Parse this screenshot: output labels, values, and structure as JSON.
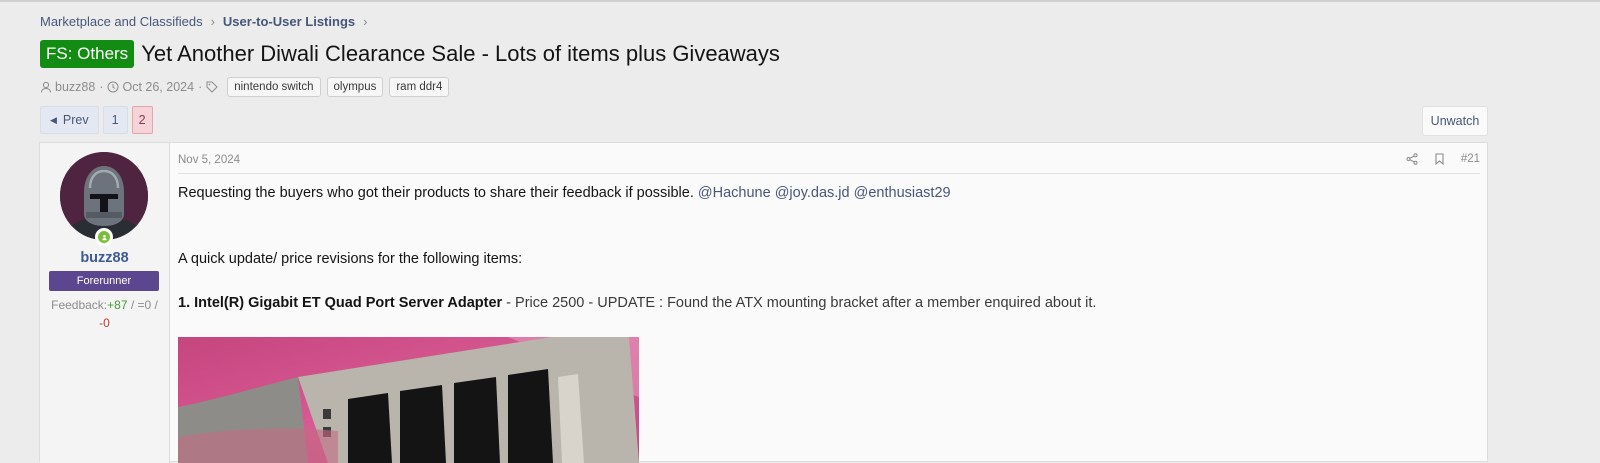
{
  "breadcrumb": {
    "items": [
      "Marketplace and Classifieds",
      "User-to-User Listings"
    ]
  },
  "thread": {
    "prefix": "FS: Others",
    "title": "Yet Another Diwali Clearance Sale - Lots of items plus Giveaways",
    "author": "buzz88",
    "date": "Oct 26, 2024",
    "tags": [
      "nintendo switch",
      "olympus",
      "ram ddr4"
    ]
  },
  "pager": {
    "prev_label": "Prev",
    "pages": [
      "1",
      "2"
    ],
    "current": "2"
  },
  "actions": {
    "unwatch_label": "Unwatch"
  },
  "post": {
    "date": "Nov 5, 2024",
    "number": "#21",
    "user": {
      "name": "buzz88",
      "title": "Forerunner",
      "feedback_label": "Feedback:",
      "feedback_pos": "+87",
      "feedback_sep1": " / ",
      "feedback_neu": "=0",
      "feedback_sep2": " /",
      "feedback_neg": "-0"
    },
    "line1": "Requesting the buyers who got their products to share their feedback if possible. ",
    "mentions": [
      "@Hachune",
      "@joy.das.jd",
      "@enthusiast29"
    ],
    "line2": "A quick update/ price revisions for the following items:",
    "item1_bold": "1. Intel(R) Gigabit ET Quad Port Server Adapter",
    "item1_rest": " - Price 2500 - UPDATE : Found the ATX mounting bracket after a member enquired about it."
  },
  "colors": {
    "prefix": "#128c12",
    "link": "#47577a",
    "usertitle": "#5c4690",
    "current_page": "#f4d4d8"
  }
}
